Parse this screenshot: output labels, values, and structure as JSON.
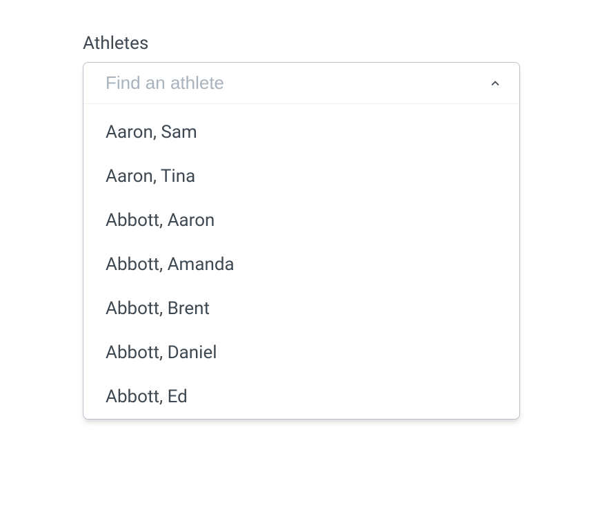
{
  "label": "Athletes",
  "combobox": {
    "placeholder": "Find an athlete",
    "value": "",
    "options": [
      "Aaron, Sam",
      "Aaron, Tina",
      "Abbott, Aaron",
      "Abbott, Amanda",
      "Abbott, Brent",
      "Abbott, Daniel",
      "Abbott, Ed"
    ]
  }
}
